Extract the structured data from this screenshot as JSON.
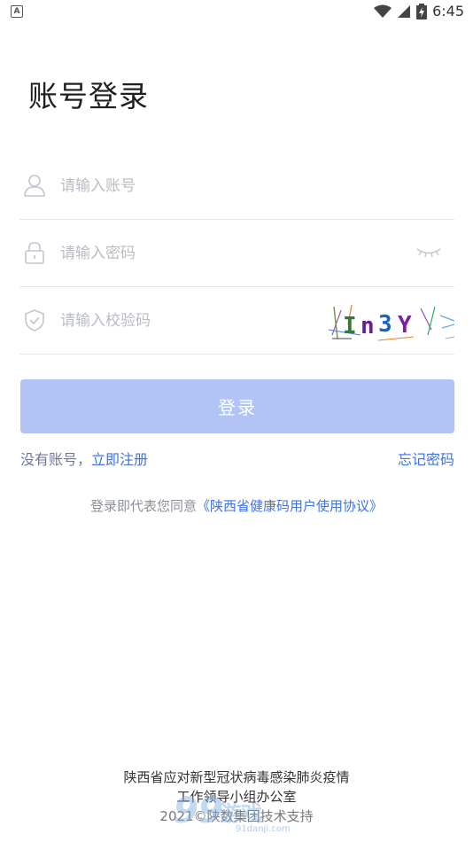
{
  "status_bar": {
    "time": "6:45",
    "notification_icon": "a-app-icon",
    "icons": [
      "wifi-icon",
      "signal-icon",
      "battery-icon"
    ]
  },
  "page": {
    "title": "账号登录"
  },
  "form": {
    "account": {
      "placeholder": "请输入账号",
      "value": "",
      "icon": "user-icon"
    },
    "password": {
      "placeholder": "请输入密码",
      "value": "",
      "icon": "lock-icon",
      "toggle_icon": "eye-closed-icon"
    },
    "captcha": {
      "placeholder": "请输入校验码",
      "value": "",
      "icon": "shield-icon",
      "image_text": "In3Y"
    },
    "login_label": "登录"
  },
  "links": {
    "no_account": "没有账号，",
    "register": "立即注册",
    "forgot_password": "忘记密码"
  },
  "agreement": {
    "prefix": "登录即代表您同意",
    "link": "《陕西省健康码用户使用协议》"
  },
  "footer": {
    "line1": "陕西省应对新型冠状病毒感染肺炎疫情",
    "line2": "工作领导小组办公室",
    "line3": "2021©陕数集团技术支持"
  },
  "colors": {
    "accent": "#3f73e6",
    "button_disabled": "#b1c4f5",
    "placeholder": "#b8bcc3",
    "divider": "#e4e6ea"
  }
}
